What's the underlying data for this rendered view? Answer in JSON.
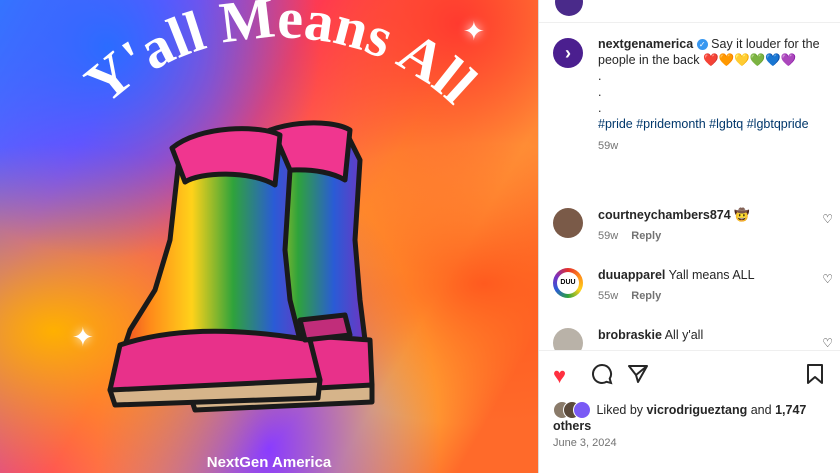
{
  "image": {
    "headline": "Y'all Means All",
    "brand": "NextGen America"
  },
  "caption": {
    "username": "nextgenamerica",
    "text": "Say it louder for the people in the back",
    "hearts": "❤️🧡💛💚💙💜",
    "dots": [
      ".",
      ".",
      "."
    ],
    "hashtags": "#pride #pridemonth #lgbtq #lgbtqpride",
    "time": "59w"
  },
  "comments": [
    {
      "username": "courtneychambers874",
      "text": "🤠",
      "time": "59w",
      "reply": "Reply"
    },
    {
      "username": "duuapparel",
      "text": "Yall means ALL",
      "time": "55w",
      "reply": "Reply",
      "avatar_text": "DUU"
    },
    {
      "username": "brobraskie",
      "text": "All y'all",
      "time": "",
      "reply": ""
    }
  ],
  "actions": {
    "icons": [
      "heart-filled-icon",
      "comment-icon",
      "share-icon",
      "bookmark-icon"
    ],
    "liked_by_prefix": "Liked by",
    "liked_by_user": "vicrodrigueztang",
    "liked_by_and": "and",
    "others": "1,747 others",
    "date": "June 3, 2024"
  },
  "colors": {
    "like_red": "#ff3040",
    "link_blue": "#00376b",
    "avatar_purple": "#4b1f8f"
  }
}
